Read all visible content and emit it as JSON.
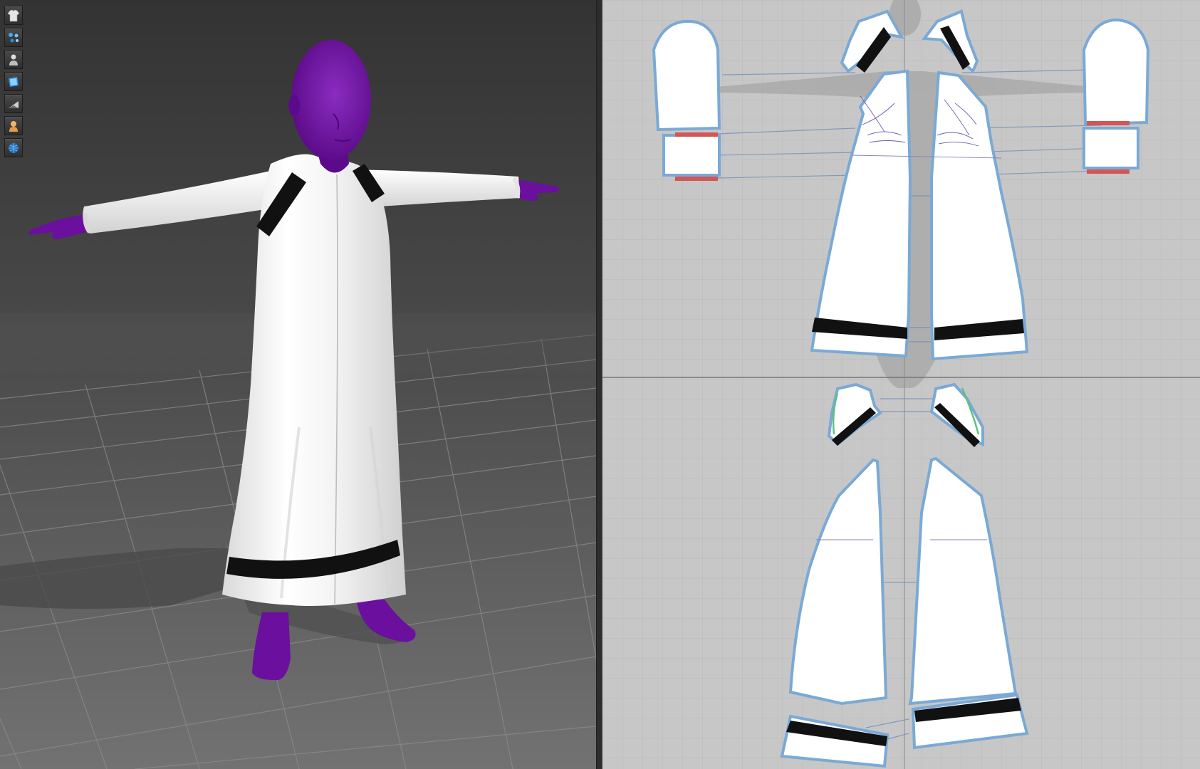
{
  "toolbar": {
    "buttons": [
      {
        "icon": "garment-icon",
        "active": false
      },
      {
        "icon": "simulation-particles-icon",
        "active": false
      },
      {
        "icon": "avatar-icon",
        "active": false
      },
      {
        "icon": "texture-view-icon",
        "active": false
      },
      {
        "icon": "shadow-icon",
        "active": false
      },
      {
        "icon": "avatar-skin-icon",
        "active": false
      },
      {
        "icon": "environment-sphere-icon",
        "active": false
      }
    ]
  },
  "colors": {
    "avatar_skin": "#6b0f9e",
    "garment_fabric": "#ffffff",
    "trim_black": "#111111",
    "pattern_outline": "#7aa9d6",
    "pattern_board": "#c7c7c7",
    "selected_edge_red": "#d45555",
    "selected_edge_green": "#5fc080"
  }
}
